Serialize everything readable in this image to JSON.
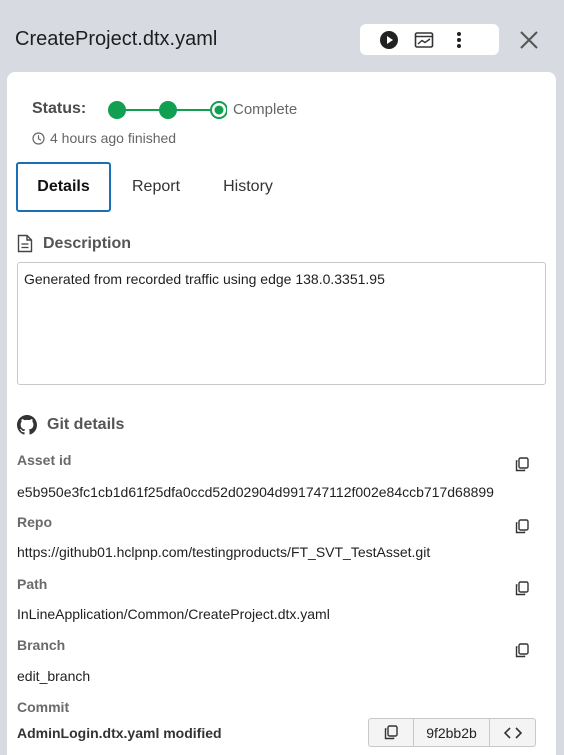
{
  "header": {
    "title": "CreateProject.dtx.yaml",
    "toolbar": {
      "run_icon": "play-circle-icon",
      "report_icon": "chart-window-icon",
      "more_icon": "vertical-dots-icon"
    },
    "close_icon": "close-icon"
  },
  "status": {
    "label": "Status:",
    "value": "Complete",
    "finished": "4 hours ago finished",
    "accent_color": "#11a052"
  },
  "tabs": [
    {
      "label": "Details",
      "active": true
    },
    {
      "label": "Report",
      "active": false
    },
    {
      "label": "History",
      "active": false
    }
  ],
  "description": {
    "title": "Description",
    "text": "Generated from recorded traffic using edge 138.0.3351.95"
  },
  "git": {
    "title": "Git details",
    "fields": {
      "asset_id": {
        "label": "Asset id",
        "value": "e5b950e3fc1cb1d61f25dfa0ccd52d02904d991747112f002e84ccb717d68899"
      },
      "repo": {
        "label": "Repo",
        "value": "https://github01.hclpnp.com/testingproducts/FT_SVT_TestAsset.git"
      },
      "path": {
        "label": "Path",
        "value": "InLineApplication/Common/CreateProject.dtx.yaml"
      },
      "branch": {
        "label": "Branch",
        "value": "edit_branch"
      }
    },
    "commit": {
      "label": "Commit",
      "message": "AdminLogin.dtx.yaml modified",
      "hash": "9f2bb2b",
      "code_icon": "code-brackets-icon"
    }
  }
}
